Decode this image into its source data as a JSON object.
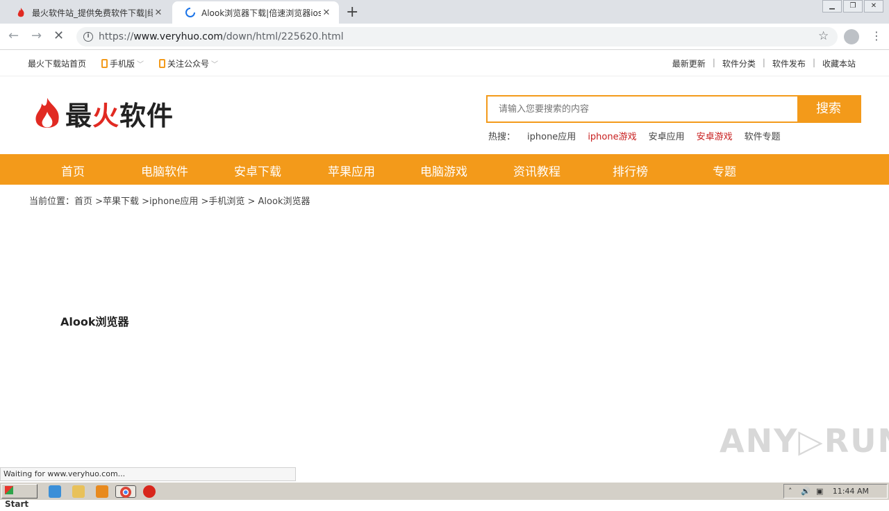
{
  "browser": {
    "tabs": [
      {
        "title": "最火软件站_提供免费软件下载|绿色",
        "close": "✕"
      },
      {
        "title": "Alook浏览器下载|倍速浏览器ios版下",
        "close": "✕"
      }
    ],
    "new_tab": "+",
    "url_scheme": "https://",
    "url_host": "www.veryhuo.com",
    "url_path": "/down/html/225620.html",
    "status_text": "Waiting for www.veryhuo.com..."
  },
  "topbar": {
    "home_link": "最火下载站首页",
    "mobile": "手机版",
    "wechat": "关注公众号",
    "right_links": [
      "最新更新",
      "软件分类",
      "软件发布",
      "收藏本站"
    ]
  },
  "logo": {
    "text_black": "最",
    "text_red": "火",
    "text_black2": "软件"
  },
  "search": {
    "placeholder": "请输入您要搜索的内容",
    "button": "搜索",
    "hot_label": "热搜：",
    "hot_items": [
      {
        "label": "iphone应用",
        "highlight": false
      },
      {
        "label": "iphone游戏",
        "highlight": true
      },
      {
        "label": "安卓应用",
        "highlight": false
      },
      {
        "label": "安卓游戏",
        "highlight": true
      },
      {
        "label": "软件专题",
        "highlight": false
      }
    ]
  },
  "nav": [
    "首页",
    "电脑软件",
    "安卓下载",
    "苹果应用",
    "电脑游戏",
    "资讯教程",
    "排行榜",
    "专题"
  ],
  "breadcrumb": "当前位置：首页 >苹果下载 >iphone应用 >手机浏览 > Alook浏览器",
  "app_title": "Alook浏览器",
  "watermark": "ANY▷RUN",
  "taskbar": {
    "start": "Start",
    "time": "11:44 AM"
  },
  "colors": {
    "accent": "#f39a1a",
    "brand_red": "#e12a22",
    "hot_red": "#c81e1e"
  }
}
